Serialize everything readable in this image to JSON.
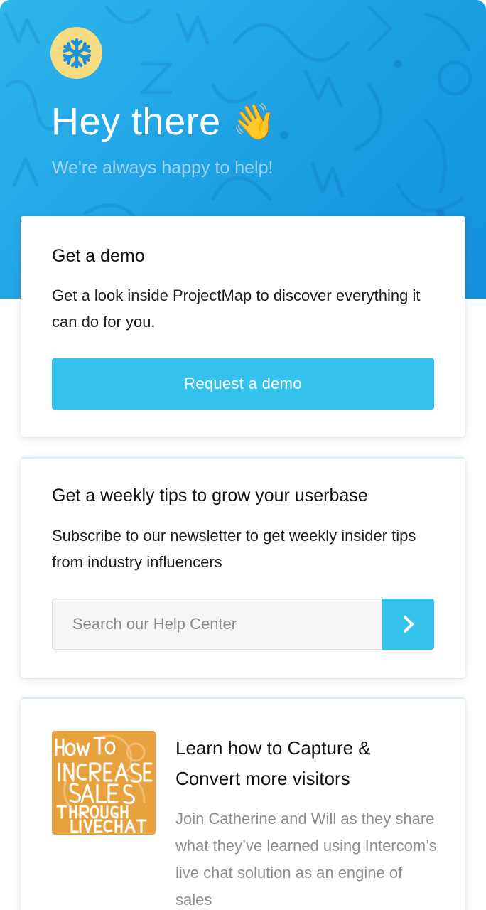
{
  "header": {
    "logo_icon": "snowflake-icon",
    "greeting": "Hey there",
    "greeting_emoji": "👋",
    "tagline": "We're always happy to help!"
  },
  "demo_card": {
    "title": "Get a demo",
    "text": "Get a look inside ProjectMap to discover everything it can do for you.",
    "button_label": "Request a demo"
  },
  "newsletter_card": {
    "title": "Get a weekly tips to grow your userbase",
    "text": "Subscribe to our newsletter to get weekly insider tips from industry influencers",
    "input_placeholder": "Search our Help Center",
    "submit_icon": "chevron-right-icon"
  },
  "learn_card": {
    "thumbnail_lettering": "How To INCREASE SALES THROUGH LIVECHAT",
    "title": "Learn how to Capture & Convert more visitors",
    "text": "Join Catherine and Will as they share what they’ve learned using Intercom’s live chat solution as an engine of sales"
  },
  "colors": {
    "hero": "#1c9fe4",
    "accent": "#33c2ec",
    "logo_bg": "#f7dc82",
    "logo_icon": "#1d92d8",
    "thumbnail_bg": "#e8a23d"
  }
}
